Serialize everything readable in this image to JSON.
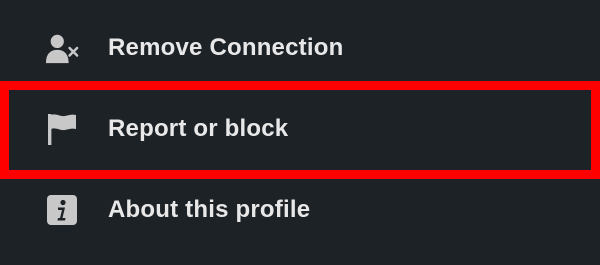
{
  "menu": {
    "items": [
      {
        "label": "Remove Connection",
        "icon": "remove-person-icon"
      },
      {
        "label": "Report or block",
        "icon": "flag-icon"
      },
      {
        "label": "About this profile",
        "icon": "info-icon"
      }
    ]
  },
  "colors": {
    "background": "#1d2226",
    "text": "#e8e8e8",
    "icon": "#c8c8c8",
    "highlight_border": "#ff0000"
  }
}
